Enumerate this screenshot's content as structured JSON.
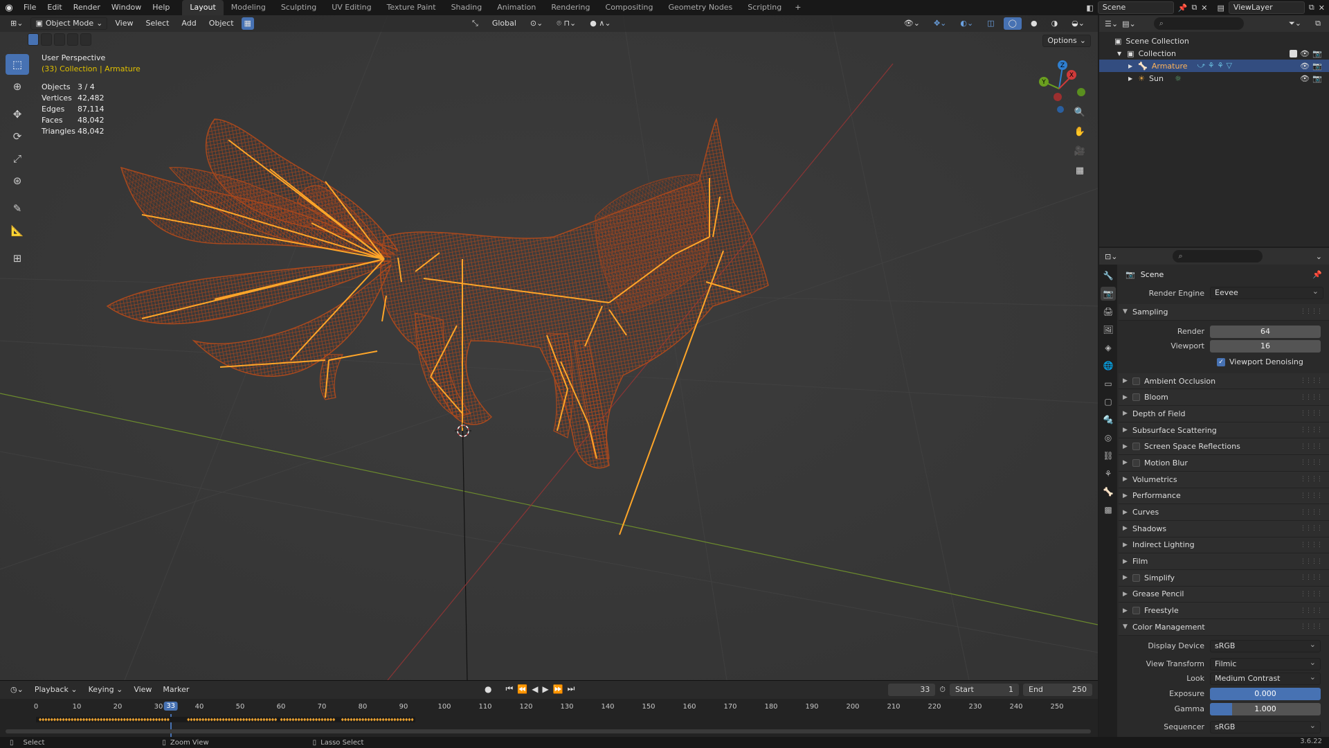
{
  "menubar": {
    "items": [
      "File",
      "Edit",
      "Render",
      "Window",
      "Help"
    ],
    "workspaces": [
      "Layout",
      "Modeling",
      "Sculpting",
      "UV Editing",
      "Texture Paint",
      "Shading",
      "Animation",
      "Rendering",
      "Compositing",
      "Geometry Nodes",
      "Scripting"
    ],
    "add": "+",
    "scene": "Scene",
    "view_layer": "ViewLayer"
  },
  "viewport": {
    "mode": "Object Mode",
    "menus": [
      "View",
      "Select",
      "Add",
      "Object"
    ],
    "transform_orientation": "Global",
    "options": "Options",
    "perspective": "User Perspective",
    "collection_info": "(33) Collection | Armature",
    "stats": [
      {
        "k": "Objects",
        "v": "3 / 4"
      },
      {
        "k": "Vertices",
        "v": "42,482"
      },
      {
        "k": "Edges",
        "v": "87,114"
      },
      {
        "k": "Faces",
        "v": "48,042"
      },
      {
        "k": "Triangles",
        "v": "48,042"
      }
    ],
    "gizmo_axes": {
      "x": "X",
      "y": "Y",
      "z": "Z"
    }
  },
  "timeline": {
    "menus": [
      "Playback",
      "Keying",
      "View",
      "Marker"
    ],
    "current_frame": "33",
    "start_label": "Start",
    "start": "1",
    "end_label": "End",
    "end": "250",
    "frame_labels": [
      "0",
      "10",
      "20",
      "30",
      "40",
      "50",
      "60",
      "70",
      "80",
      "90",
      "100",
      "110",
      "120",
      "130",
      "140",
      "150",
      "160",
      "170",
      "180",
      "190",
      "200",
      "210",
      "220",
      "230",
      "240",
      "250"
    ]
  },
  "statusbar": {
    "select": "Select",
    "zoom": "Zoom View",
    "lasso": "Lasso Select",
    "version": "3.6.22"
  },
  "outliner": {
    "root": "Scene Collection",
    "collection": "Collection",
    "items": [
      "Armature",
      "Sun"
    ]
  },
  "properties": {
    "title": "Scene",
    "render_engine_label": "Render Engine",
    "render_engine": "Eevee",
    "sampling": {
      "title": "Sampling",
      "render_label": "Render",
      "render": "64",
      "viewport_label": "Viewport",
      "viewport": "16",
      "denoise": "Viewport Denoising"
    },
    "panels": [
      {
        "label": "Ambient Occlusion",
        "checkbox": true
      },
      {
        "label": "Bloom",
        "checkbox": true
      },
      {
        "label": "Depth of Field",
        "checkbox": false
      },
      {
        "label": "Subsurface Scattering",
        "checkbox": false
      },
      {
        "label": "Screen Space Reflections",
        "checkbox": true
      },
      {
        "label": "Motion Blur",
        "checkbox": true
      },
      {
        "label": "Volumetrics",
        "checkbox": false
      },
      {
        "label": "Performance",
        "checkbox": false
      },
      {
        "label": "Curves",
        "checkbox": false
      },
      {
        "label": "Shadows",
        "checkbox": false
      },
      {
        "label": "Indirect Lighting",
        "checkbox": false
      },
      {
        "label": "Film",
        "checkbox": false
      },
      {
        "label": "Simplify",
        "checkbox": true
      },
      {
        "label": "Grease Pencil",
        "checkbox": false
      },
      {
        "label": "Freestyle",
        "checkbox": true
      }
    ],
    "color_management": {
      "title": "Color Management",
      "display_device_label": "Display Device",
      "display_device": "sRGB",
      "view_transform_label": "View Transform",
      "view_transform": "Filmic",
      "look_label": "Look",
      "look": "Medium Contrast",
      "exposure_label": "Exposure",
      "exposure": "0.000",
      "gamma_label": "Gamma",
      "gamma": "1.000",
      "gamma_fill": 0.2,
      "sequencer_label": "Sequencer",
      "sequencer": "sRGB"
    }
  },
  "colors": {
    "accent": "#4772b3",
    "mesh": "#b04a1c",
    "bones": "#ffa629"
  }
}
